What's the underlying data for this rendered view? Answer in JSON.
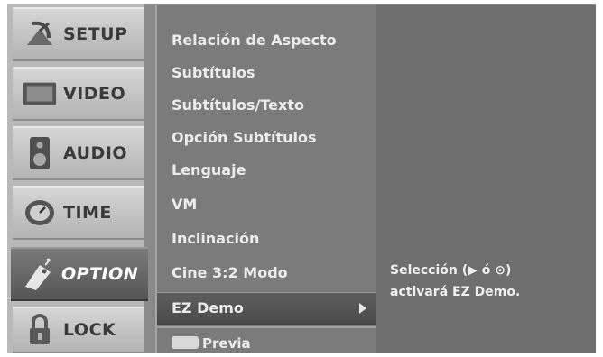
{
  "sidebar": {
    "tabs": [
      {
        "label": "SETUP",
        "icon": "satellite-dish-icon"
      },
      {
        "label": "VIDEO",
        "icon": "tv-screen-icon"
      },
      {
        "label": "AUDIO",
        "icon": "speaker-icon"
      },
      {
        "label": "TIME",
        "icon": "clock-icon"
      },
      {
        "label": "OPTION",
        "icon": "tag-icon",
        "active": true
      },
      {
        "label": "LOCK",
        "icon": "padlock-icon"
      }
    ]
  },
  "menu": {
    "items": [
      "Relación de Aspecto",
      "Subtítulos",
      "Subtítulos/Texto",
      "Opción Subtítulos",
      "Lenguaje",
      "VM",
      "Inclinación",
      "Cine 3:2 Modo",
      "EZ Demo"
    ],
    "selected_index": 8,
    "footer_label": "Previa"
  },
  "info": {
    "line1": "Selección (▶ ó ⊙)",
    "line2": "activará EZ Demo."
  },
  "colors": {
    "panel": "#7b7b7b",
    "info_bg": "#6e6e6e",
    "active_tab": "#5a5a5a"
  }
}
